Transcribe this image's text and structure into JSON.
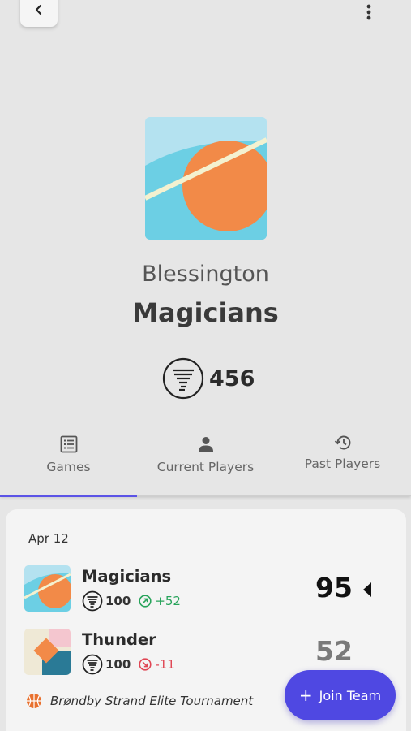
{
  "header": {
    "back_icon": "chevron-left-icon",
    "more_icon": "more-vertical-icon"
  },
  "team": {
    "city": "Blessington",
    "name": "Magicians",
    "rating": "456",
    "rating_icon": "tornado-badge-icon"
  },
  "tabs": [
    {
      "label": "Games",
      "icon": "list-icon",
      "active": true
    },
    {
      "label": "Current Players",
      "icon": "person-icon",
      "active": false
    },
    {
      "label": "Past Players",
      "icon": "history-icon",
      "active": false
    }
  ],
  "colors": {
    "accent": "#5b53e6",
    "positive": "#27a35a",
    "negative": "#e04654",
    "logo_orange": "#f28a48",
    "logo_blue": "#6ccfe4"
  },
  "game": {
    "date": "Apr 12",
    "teams": [
      {
        "name": "Magicians",
        "rating": "100",
        "delta": "+52",
        "delta_type": "up",
        "score": "95",
        "winner": true
      },
      {
        "name": "Thunder",
        "rating": "100",
        "delta": "-11",
        "delta_type": "down",
        "score": "52",
        "winner": false
      }
    ],
    "tournament": "Brøndby Strand Elite Tournament",
    "tournament_icon": "basketball-icon"
  },
  "fab": {
    "label": "Join Team",
    "icon": "plus-icon"
  }
}
